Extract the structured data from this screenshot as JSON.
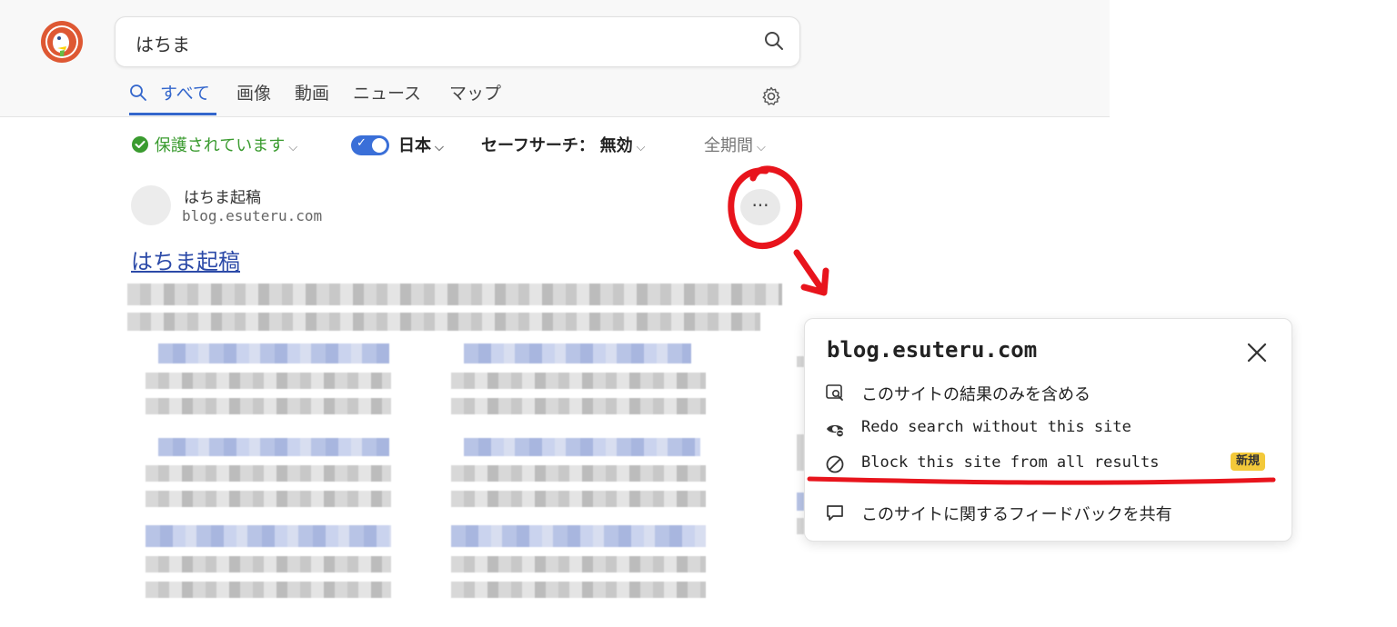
{
  "search": {
    "query": "はちま"
  },
  "tabs": [
    {
      "label": "すべて"
    },
    {
      "label": "画像"
    },
    {
      "label": "動画"
    },
    {
      "label": "ニュース"
    },
    {
      "label": "マップ"
    }
  ],
  "filters": {
    "protection": "保護されています",
    "region": "日本",
    "safe_search_label": "セーフサーチ：",
    "safe_search_value": "無効",
    "time": "全期間"
  },
  "result": {
    "site_name": "はちま起稿",
    "url": "blog.esuteru.com",
    "title": "はちま起稿",
    "more_label": "···"
  },
  "popup": {
    "title": "blog.esuteru.com",
    "items": [
      {
        "label": "このサイトの結果のみを含める",
        "icon": "site-search-icon"
      },
      {
        "label": "Redo search without this site",
        "icon": "eye-slash-icon"
      },
      {
        "label": "Block this site from all results",
        "icon": "block-icon",
        "badge": "新規"
      },
      {
        "label": "このサイトに関するフィードバックを共有",
        "icon": "comment-icon"
      }
    ]
  },
  "colors": {
    "accent": "#3366cc",
    "link": "#2c4aa8",
    "protected": "#3a9b2f",
    "annotation": "#e8141c",
    "badge": "#f3c93a"
  }
}
